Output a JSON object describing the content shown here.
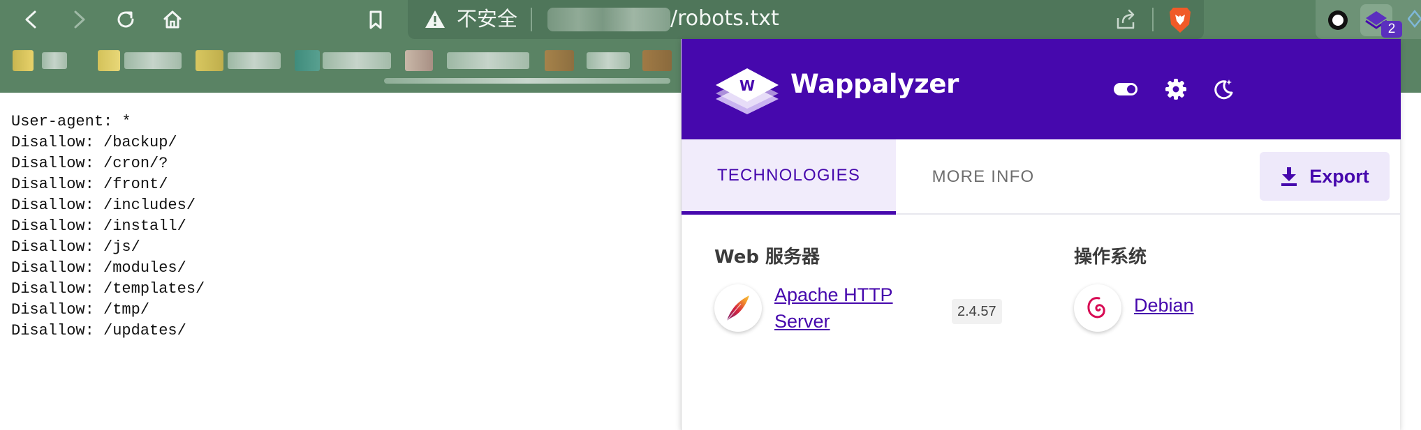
{
  "browser": {
    "nav": {
      "back_icon": "back-arrow-icon",
      "forward_icon": "forward-arrow-icon",
      "reload_icon": "reload-icon",
      "home_icon": "home-icon",
      "bookmark_icon": "bookmark-icon"
    },
    "omnibox": {
      "security_status": "不安全",
      "url_path": "/robots.txt"
    },
    "extensions": {
      "badge_count": "2"
    },
    "colors": {
      "chrome_bg": "#5a8364",
      "omnibox_bg": "#4f765a"
    }
  },
  "page": {
    "robots_lines": [
      "User-agent: *",
      "Disallow: /backup/",
      "Disallow: /cron/?",
      "Disallow: /front/",
      "Disallow: /includes/",
      "Disallow: /install/",
      "Disallow: /js/",
      "Disallow: /modules/",
      "Disallow: /templates/",
      "Disallow: /tmp/",
      "Disallow: /updates/"
    ]
  },
  "wappalyzer": {
    "title": "Wappalyzer",
    "header_icons": [
      "toggle-icon",
      "settings-gear-icon",
      "dark-mode-moon-icon"
    ],
    "tabs": [
      {
        "label": "TECHNOLOGIES",
        "active": true
      },
      {
        "label": "MORE INFO",
        "active": false
      }
    ],
    "export_label": "Export",
    "categories": [
      {
        "name": "Web 服务器",
        "technologies": [
          {
            "name_line1": "Apache HTTP",
            "name_line2": "Server",
            "version": "2.4.57",
            "icon": "apache-feather-icon"
          }
        ]
      },
      {
        "name": "操作系统",
        "technologies": [
          {
            "name": "Debian",
            "icon": "debian-swirl-icon"
          }
        ]
      }
    ],
    "colors": {
      "brand": "#4608ad",
      "tab_active_bg": "#f1ecfb",
      "export_bg": "#eee9fa"
    }
  }
}
